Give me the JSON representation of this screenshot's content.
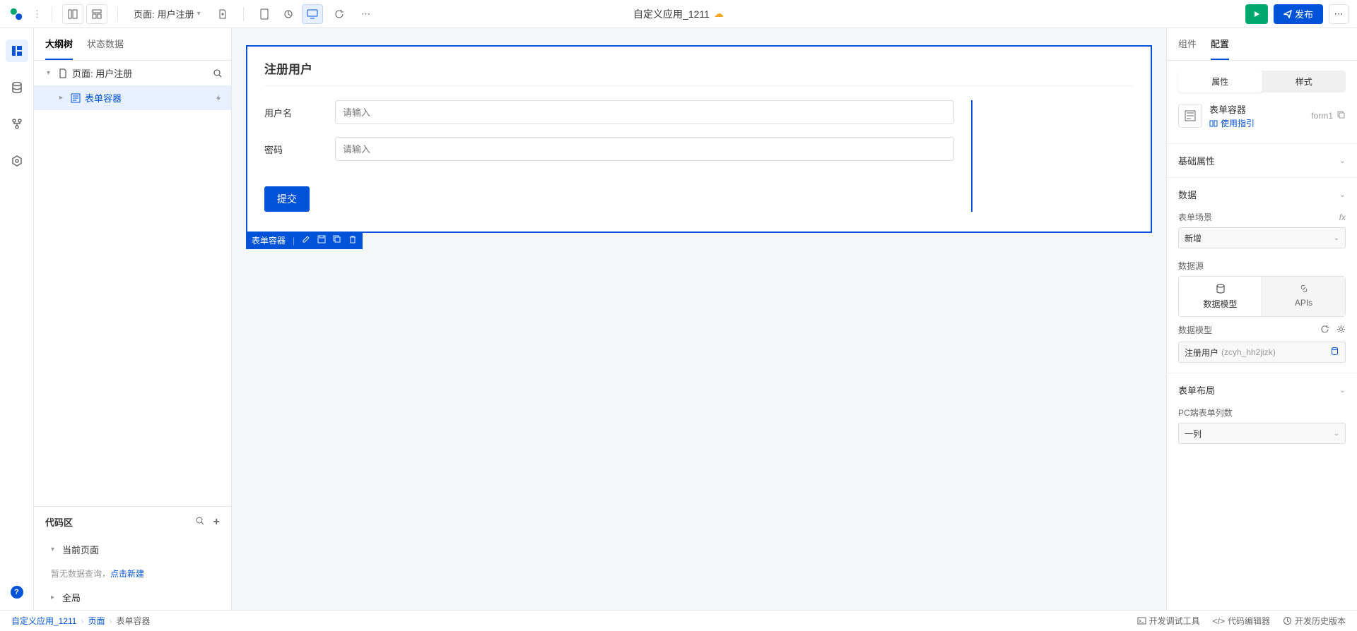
{
  "topbar": {
    "page_label": "页面:",
    "page_name": "用户注册",
    "app_title": "自定义应用_1211",
    "publish": "发布"
  },
  "left_tabs": {
    "outline": "大纲树",
    "state": "状态数据"
  },
  "tree": {
    "page_prefix": "页面:",
    "page_name": "用户注册",
    "form_container": "表单容器"
  },
  "code_area": {
    "title": "代码区",
    "current_page": "当前页面",
    "empty_prefix": "暂无数据查询，",
    "empty_link": "点击新建",
    "global": "全局"
  },
  "canvas": {
    "title": "注册用户",
    "username_label": "用户名",
    "username_placeholder": "请输入",
    "password_label": "密码",
    "password_placeholder": "请输入",
    "submit": "提交",
    "selection_label": "表单容器"
  },
  "right": {
    "tab_components": "组件",
    "tab_config": "配置",
    "attr": "属性",
    "style": "样式",
    "comp_name": "表单容器",
    "comp_id": "form1",
    "guide": "使用指引",
    "sec_basic": "基础属性",
    "sec_data": "数据",
    "form_scene": "表单场景",
    "scene_value": "新增",
    "data_source": "数据源",
    "ds_model": "数据模型",
    "ds_apis": "APIs",
    "model_label": "数据模型",
    "model_name": "注册用户",
    "model_code": "(zcyh_hh2jizk)",
    "sec_layout": "表单布局",
    "pc_columns": "PC端表单列数",
    "columns_value": "一列"
  },
  "bottom": {
    "crumb1": "自定义应用_1211",
    "crumb2": "页面",
    "crumb3": "表单容器",
    "debug": "开发调试工具",
    "editor": "代码编辑器",
    "history": "开发历史版本"
  }
}
